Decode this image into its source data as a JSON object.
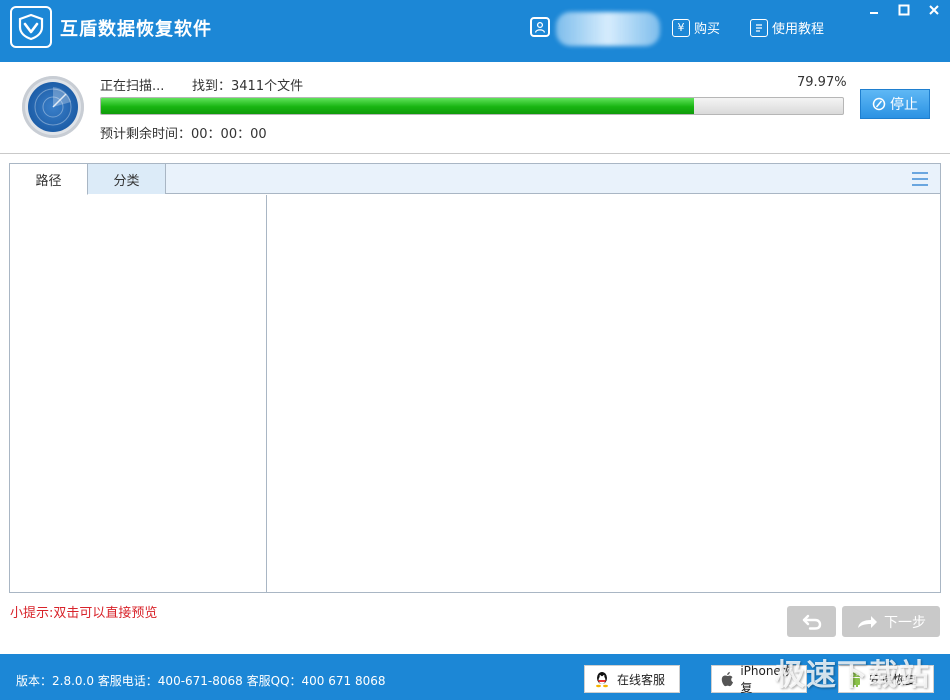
{
  "app": {
    "title": "互盾数据恢复软件"
  },
  "header": {
    "buy_label": "购买",
    "buy_icon_glyph": "¥",
    "tutorial_label": "使用教程"
  },
  "scan": {
    "status": "正在扫描...",
    "found_label": "找到：3411个文件",
    "percent_text": "79.97%",
    "progress": 0.7997,
    "remaining": "预计剩余时间：00：00：00",
    "stop_label": "停止"
  },
  "tabs": [
    {
      "label": "路径",
      "active": true
    },
    {
      "label": "分类",
      "active": false
    }
  ],
  "tip": "小提示:双击可以直接预览",
  "nav": {
    "next_label": "下一步"
  },
  "footer": {
    "info": "版本：2.8.0.0 客服电话：400-671-8068    客服QQ：400 671 8068",
    "online_service_label": "在线客服",
    "iphone_label": "iPhone恢复",
    "android_label": "安卓恢复"
  },
  "watermark": "极速下载站",
  "colors": {
    "primary": "#1c87d6",
    "progress": "#18b512",
    "tip_text": "#d8232a"
  }
}
